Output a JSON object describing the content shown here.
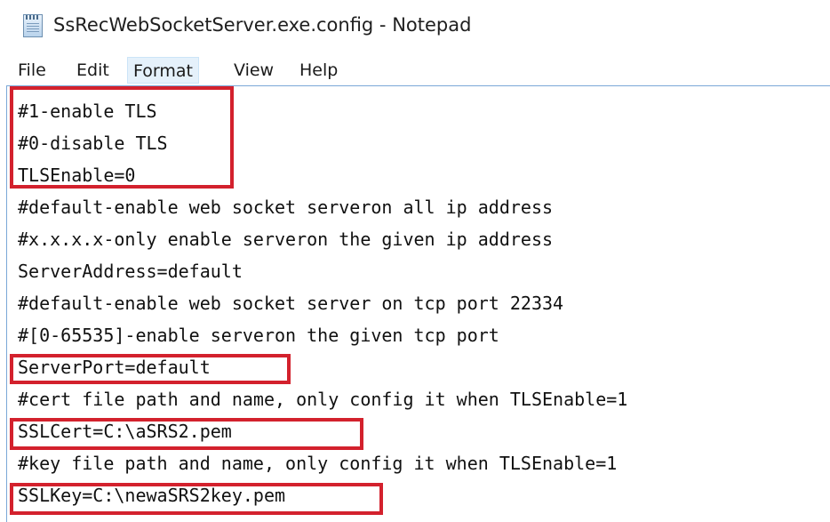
{
  "window": {
    "title": "SsRecWebSocketServer.exe.config - Notepad",
    "icon": "notepad-icon"
  },
  "menu": [
    {
      "label": "File"
    },
    {
      "label": "Edit"
    },
    {
      "label": "Format",
      "active": true
    },
    {
      "label": "View"
    },
    {
      "label": "Help"
    }
  ],
  "editor": {
    "lines": [
      "#1-enable TLS",
      "#0-disable TLS",
      "TLSEnable=0",
      "#default-enable web socket serveron all ip address",
      "#x.x.x.x-only enable serveron the given ip address",
      "ServerAddress=default",
      "#default-enable web socket server on tcp port 22334",
      "#[0-65535]-enable serveron the given tcp port",
      "ServerPort=default",
      "#cert file path and name, only config it when TLSEnable=1",
      "SSLCert=C:\\aSRS2.pem",
      "#key file path and name, only config it when TLSEnable=1",
      "SSLKey=C:\\newaSRS2key.pem"
    ]
  },
  "colors": {
    "highlight_border": "#d3212d",
    "menu_active_bg": "#e5f1fb",
    "editor_border": "#7aa7d8"
  }
}
